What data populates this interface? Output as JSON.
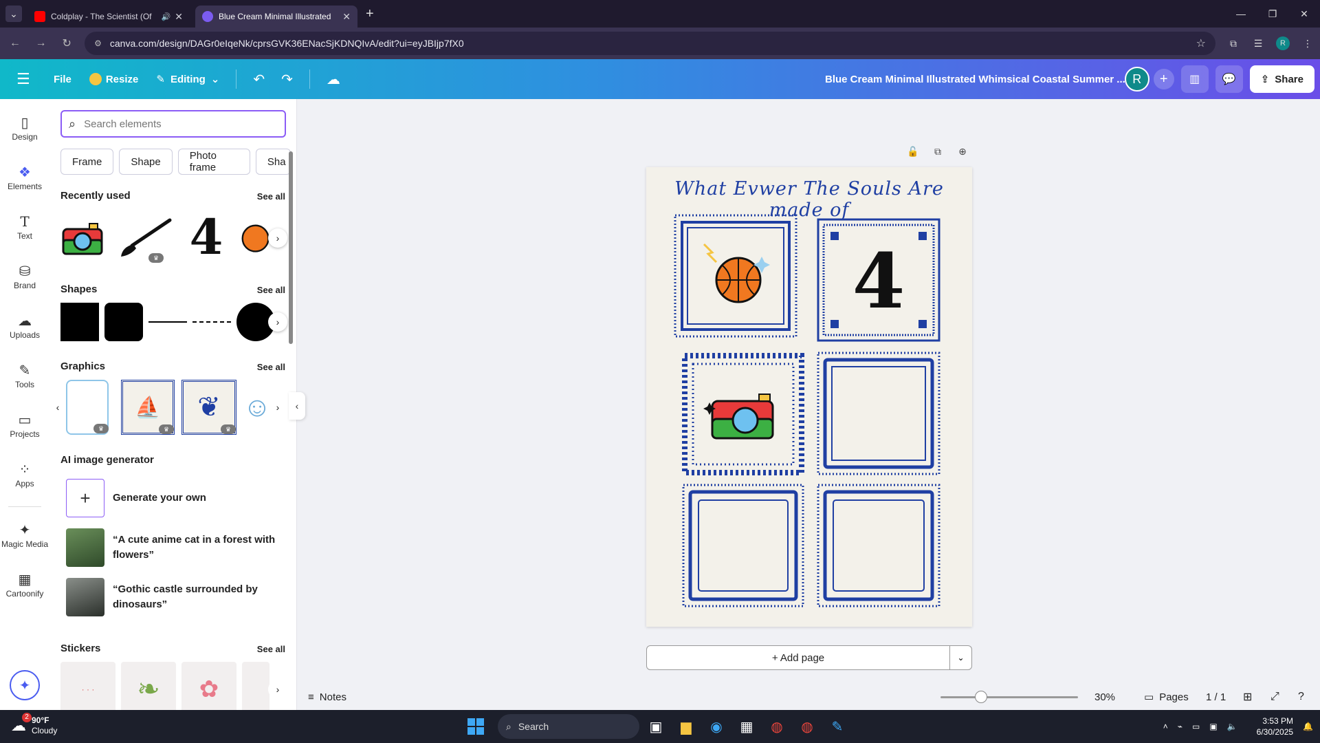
{
  "browser": {
    "tabs": [
      {
        "title": "Coldplay - The Scientist (Of",
        "favicon_color": "#ff0000"
      },
      {
        "title": "Blue Cream Minimal Illustrated",
        "favicon_color": "#7b5cf0"
      }
    ],
    "url": "canva.com/design/DAGr0eIqeNk/cprsGVK36ENacSjKDNQIvA/edit?ui=eyJBIjp7fX0",
    "profile_initial": "R"
  },
  "header": {
    "file_label": "File",
    "resize_label": "Resize",
    "editing_label": "Editing",
    "doc_title": "Blue Cream Minimal Illustrated Whimsical Coastal Summer ...",
    "avatar_initial": "R",
    "share_label": "Share"
  },
  "rail": {
    "items": [
      {
        "label": "Design",
        "icon": "design-icon"
      },
      {
        "label": "Elements",
        "icon": "elements-icon"
      },
      {
        "label": "Text",
        "icon": "text-icon"
      },
      {
        "label": "Brand",
        "icon": "brand-icon"
      },
      {
        "label": "Uploads",
        "icon": "uploads-icon"
      },
      {
        "label": "Tools",
        "icon": "tools-icon"
      },
      {
        "label": "Projects",
        "icon": "projects-icon"
      },
      {
        "label": "Apps",
        "icon": "apps-icon"
      },
      {
        "label": "Magic Media",
        "icon": "magic-media-icon"
      },
      {
        "label": "Cartoonify",
        "icon": "cartoonify-icon"
      }
    ]
  },
  "panel": {
    "search_placeholder": "Search elements",
    "chips": [
      "Frame",
      "Shape",
      "Photo frame",
      "Sha"
    ],
    "recently_used": "Recently used",
    "shapes": "Shapes",
    "graphics": "Graphics",
    "ai_generator": "AI image generator",
    "stickers": "Stickers",
    "see_all": "See all",
    "generate_own": "Generate your own",
    "ai_prompts": [
      "“A cute anime cat in a forest with flowers”",
      "“Gothic castle surrounded by dinosaurs”"
    ]
  },
  "canvas": {
    "page_title": "What Evwer The Souls Are made of",
    "add_page": "+ Add page"
  },
  "bottombar": {
    "notes": "Notes",
    "zoom": "30%",
    "zoom_fraction": 0.3,
    "pages": "Pages",
    "page_count": "1 / 1"
  },
  "taskbar": {
    "temp": "90°F",
    "condition": "Cloudy",
    "weather_badge": "2",
    "search": "Search",
    "time": "3:53 PM",
    "date": "6/30/2025"
  },
  "colors": {
    "accent": "#8b5cf6",
    "frame_blue": "#1f3fa3",
    "page_bg": "#f3f1ea"
  }
}
